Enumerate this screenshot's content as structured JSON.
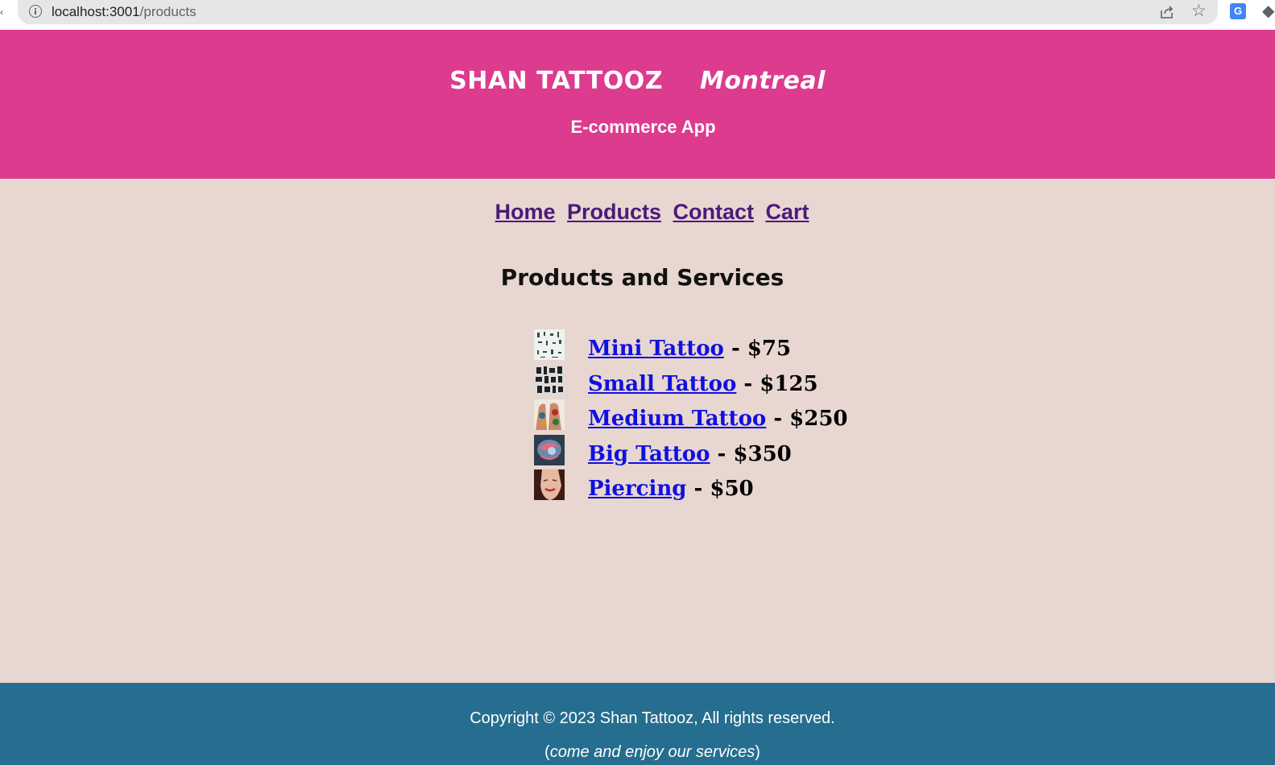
{
  "browser": {
    "url_host": "localhost:3001",
    "url_path": "/products",
    "icons": [
      "info-icon",
      "share-icon",
      "star-icon",
      "translate-icon",
      "extensions-icon"
    ]
  },
  "header": {
    "brand": "SHAN TATTOOZ",
    "city": "Montreal",
    "subtitle": "E-commerce App",
    "background": "#dc3b8e"
  },
  "nav": {
    "items": [
      {
        "label": "Home"
      },
      {
        "label": "Products"
      },
      {
        "label": "Contact"
      },
      {
        "label": "Cart"
      }
    ],
    "link_color": "#4b1a7a"
  },
  "main": {
    "title": "Products and Services",
    "background": "#e8d6d0",
    "products": [
      {
        "name": "Mini Tattoo",
        "price": " - $75",
        "thumb": "mini-tattoo-thumbnail"
      },
      {
        "name": "Small Tattoo",
        "price": " - $125",
        "thumb": "small-tattoo-thumbnail"
      },
      {
        "name": "Medium Tattoo",
        "price": " - $250",
        "thumb": "medium-tattoo-thumbnail"
      },
      {
        "name": "Big Tattoo",
        "price": " - $350",
        "thumb": "big-tattoo-thumbnail"
      },
      {
        "name": "Piercing",
        "price": " - $50",
        "thumb": "piercing-thumbnail"
      }
    ]
  },
  "footer": {
    "copyright": "Copyright © 2023 Shan Tattooz, All rights reserved.",
    "tagline_open": "(",
    "tagline": "come and enjoy our services",
    "tagline_close": ")",
    "background": "#256e8f"
  }
}
